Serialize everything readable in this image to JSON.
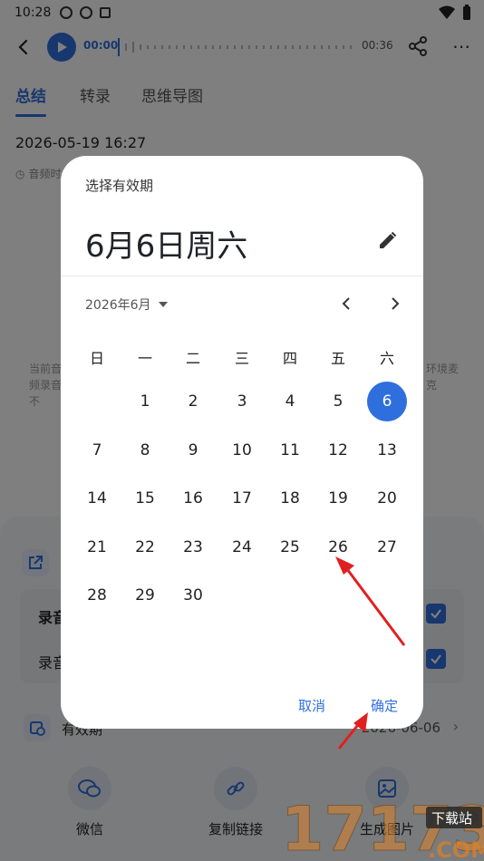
{
  "status_bar": {
    "time": "10:28"
  },
  "audio": {
    "current": "00:00",
    "total": "00:36"
  },
  "tabs": [
    "总结",
    "转录",
    "思维导图"
  ],
  "record_date": "2026-05-19 16:27",
  "meta_fragment": "音频时",
  "bg_hint_left": "当前音频录音不",
  "bg_hint_right": "环境麦克",
  "sheet": {
    "option_1": "录音",
    "option_2": "录音",
    "validity_label": "有效期",
    "validity_value": "2026-06-06",
    "share_items": [
      "微信",
      "复制链接",
      "生成图片"
    ]
  },
  "dialog": {
    "title": "选择有效期",
    "selected_date": "6月6日周六",
    "month_label": "2026年6月",
    "weekdays": [
      "日",
      "一",
      "二",
      "三",
      "四",
      "五",
      "六"
    ],
    "first_weekday_index": 1,
    "days_in_month": 30,
    "selected_day": 6,
    "cancel": "取消",
    "ok": "确定"
  },
  "colors": {
    "accent": "#2f6fdd",
    "arrow": "#e02020"
  },
  "watermark": {
    "brand": "17173",
    "tag": "下载站",
    "domain": ".COM"
  }
}
